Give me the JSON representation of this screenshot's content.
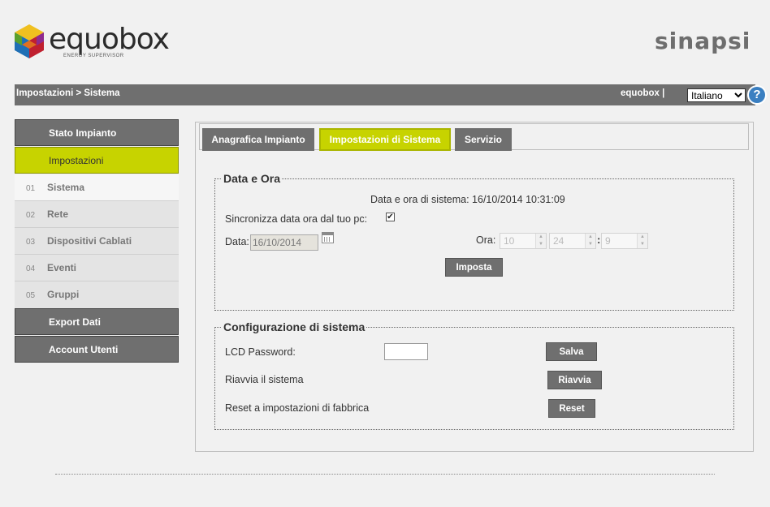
{
  "header": {
    "brand_left": "equobox",
    "brand_left_sub": "ENERGY SUPERVISOR",
    "brand_right": "sinapsi"
  },
  "topbar": {
    "breadcrumb": "Impostazioni > Sistema",
    "user": "equobox |",
    "language": "Italiano",
    "help": "?"
  },
  "sidebar": {
    "items": [
      {
        "label": "Stato Impianto"
      },
      {
        "label": "Impostazioni"
      },
      {
        "num": "01",
        "label": "Sistema"
      },
      {
        "num": "02",
        "label": "Rete"
      },
      {
        "num": "03",
        "label": "Dispositivi Cablati"
      },
      {
        "num": "04",
        "label": "Eventi"
      },
      {
        "num": "05",
        "label": "Gruppi"
      },
      {
        "label": "Export Dati"
      },
      {
        "label": "Account Utenti"
      }
    ]
  },
  "tabs": [
    {
      "label": "Anagrafica Impianto"
    },
    {
      "label": "Impostazioni di Sistema"
    },
    {
      "label": "Servizio"
    }
  ],
  "datetime": {
    "legend": "Data e Ora",
    "system_time": "Data e ora di sistema: 16/10/2014 10:31:09",
    "sync_label": "Sincronizza data ora dal tuo pc:",
    "sync_checked": true,
    "date_label": "Data:",
    "date_value": "16/10/2014",
    "time_label": "Ora:",
    "hour": "10",
    "minute": "24",
    "second": "9",
    "separator": ":",
    "set_button": "Imposta"
  },
  "config": {
    "legend": "Configurazione di sistema",
    "lcd_label": "LCD Password:",
    "lcd_value": "",
    "save_button": "Salva",
    "reboot_label": "Riavvia il sistema",
    "reboot_button": "Riavvia",
    "reset_label": "Reset a impostazioni di fabbrica",
    "reset_button": "Reset"
  },
  "colors": {
    "accent": "#c7d300",
    "bar": "#6f6f6f",
    "help": "#3a7fc1",
    "sinapsi_accent": "#f39c12"
  }
}
